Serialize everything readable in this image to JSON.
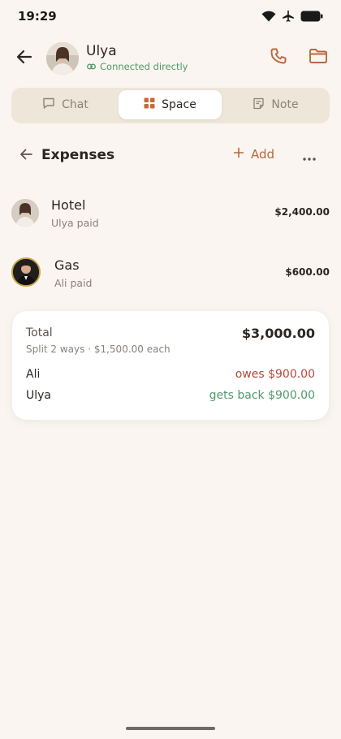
{
  "status_bar": {
    "time": "19:29"
  },
  "header": {
    "contact_name": "Ulya",
    "contact_status": "Connected directly",
    "icons": {
      "back": "arrow-left-icon",
      "phone": "phone-icon",
      "folder": "folder-icon",
      "link": "link-icon"
    }
  },
  "tabs": [
    {
      "label": "Chat",
      "icon": "chat-bubble-icon",
      "selected": false
    },
    {
      "label": "Space",
      "icon": "grid-icon",
      "selected": true
    },
    {
      "label": "Note",
      "icon": "note-icon",
      "selected": false
    }
  ],
  "section": {
    "title": "Expenses",
    "add_label": "Add",
    "icons": {
      "back": "arrow-left-icon",
      "add": "plus-icon",
      "more": "more-horizontal-icon"
    }
  },
  "expenses": [
    {
      "name": "Hotel",
      "paid_by": "Ulya paid",
      "amount": "$2,400.00"
    },
    {
      "name": "Gas",
      "paid_by": "Ali paid",
      "amount": "$600.00"
    }
  ],
  "summary": {
    "total_label": "Total",
    "total_value": "$3,000.00",
    "split_text": "Split 2 ways · $1,500.00 each",
    "rows": [
      {
        "person": "Ali",
        "status": "owes $900.00"
      },
      {
        "person": "Ulya",
        "status": "gets back $900.00"
      }
    ]
  },
  "colors": {
    "background": "#faf5f0",
    "accent": "#b8683e",
    "positive": "#4f9a6b",
    "negative": "#b04a3c",
    "tab_track": "#efe6da"
  }
}
